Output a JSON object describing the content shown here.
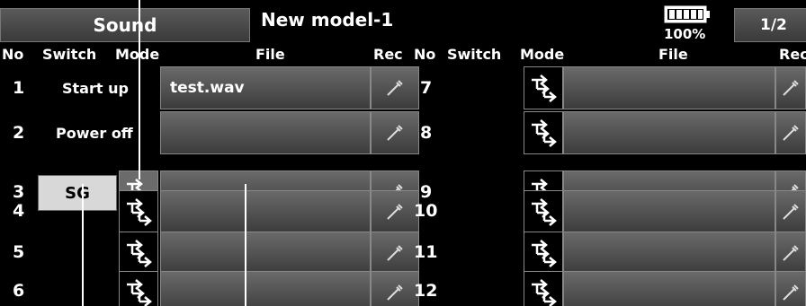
{
  "header": {
    "title": "Sound",
    "model_name": "New model-1",
    "battery_percent": "100%",
    "page": "1/2"
  },
  "columns": {
    "no": "No",
    "switch": "Switch",
    "mode": "Mode",
    "file": "File",
    "rec": "Rec"
  },
  "left_rows": [
    {
      "no": "1",
      "switch": "Start up",
      "file": "test.wav"
    },
    {
      "no": "2",
      "switch": "Power off",
      "file": ""
    },
    {
      "no": "3",
      "switch": "SG",
      "file": ""
    },
    {
      "no": "4",
      "switch": "",
      "file": ""
    },
    {
      "no": "5",
      "switch": "",
      "file": ""
    },
    {
      "no": "6",
      "switch": "",
      "file": ""
    }
  ],
  "right_rows": [
    {
      "no": "7",
      "file": ""
    },
    {
      "no": "8",
      "file": ""
    },
    {
      "no": "9",
      "file": ""
    },
    {
      "no": "10",
      "file": ""
    },
    {
      "no": "11",
      "file": ""
    },
    {
      "no": "12",
      "file": ""
    }
  ],
  "icons": {
    "mode": "mode-arrows-icon",
    "rec": "microphone-icon",
    "battery": "battery-icon"
  },
  "colors": {
    "background": "#000000",
    "button_gradient_top": "#6a6a6a",
    "button_gradient_bottom": "#3c3c3c",
    "selected_switch": "#d8d8d8",
    "active_mode": "#6b6b6b"
  }
}
